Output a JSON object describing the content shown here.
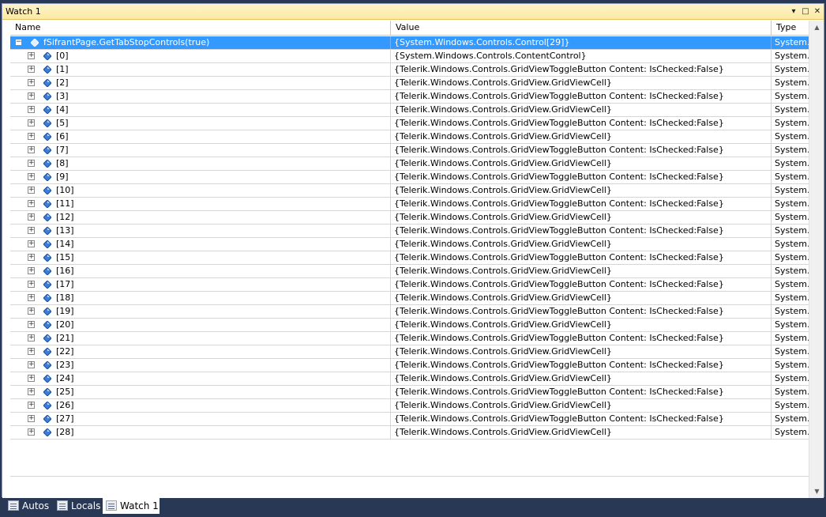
{
  "window": {
    "title": "Watch 1",
    "controls": {
      "dropdown": "▾",
      "maximize": "□",
      "close": "✕"
    }
  },
  "columns": {
    "name": "Name",
    "value": "Value",
    "type": "Type"
  },
  "root": {
    "expander": "−",
    "name": "fSifrantPage.GetTabStopControls(true)",
    "value": "{System.Windows.Controls.Control[29]}",
    "type": "System.W"
  },
  "rows": [
    {
      "name": "[0]",
      "value": "{System.Windows.Controls.ContentControl}",
      "type": "System.W"
    },
    {
      "name": "[1]",
      "value": "{Telerik.Windows.Controls.GridViewToggleButton Content: IsChecked:False}",
      "type": "System.W"
    },
    {
      "name": "[2]",
      "value": "{Telerik.Windows.Controls.GridView.GridViewCell}",
      "type": "System.W"
    },
    {
      "name": "[3]",
      "value": "{Telerik.Windows.Controls.GridViewToggleButton Content: IsChecked:False}",
      "type": "System.W"
    },
    {
      "name": "[4]",
      "value": "{Telerik.Windows.Controls.GridView.GridViewCell}",
      "type": "System.W"
    },
    {
      "name": "[5]",
      "value": "{Telerik.Windows.Controls.GridViewToggleButton Content: IsChecked:False}",
      "type": "System.W"
    },
    {
      "name": "[6]",
      "value": "{Telerik.Windows.Controls.GridView.GridViewCell}",
      "type": "System.W"
    },
    {
      "name": "[7]",
      "value": "{Telerik.Windows.Controls.GridViewToggleButton Content: IsChecked:False}",
      "type": "System.W"
    },
    {
      "name": "[8]",
      "value": "{Telerik.Windows.Controls.GridView.GridViewCell}",
      "type": "System.W"
    },
    {
      "name": "[9]",
      "value": "{Telerik.Windows.Controls.GridViewToggleButton Content: IsChecked:False}",
      "type": "System.W"
    },
    {
      "name": "[10]",
      "value": "{Telerik.Windows.Controls.GridView.GridViewCell}",
      "type": "System.W"
    },
    {
      "name": "[11]",
      "value": "{Telerik.Windows.Controls.GridViewToggleButton Content: IsChecked:False}",
      "type": "System.W"
    },
    {
      "name": "[12]",
      "value": "{Telerik.Windows.Controls.GridView.GridViewCell}",
      "type": "System.W"
    },
    {
      "name": "[13]",
      "value": "{Telerik.Windows.Controls.GridViewToggleButton Content: IsChecked:False}",
      "type": "System.W"
    },
    {
      "name": "[14]",
      "value": "{Telerik.Windows.Controls.GridView.GridViewCell}",
      "type": "System.W"
    },
    {
      "name": "[15]",
      "value": "{Telerik.Windows.Controls.GridViewToggleButton Content: IsChecked:False}",
      "type": "System.W"
    },
    {
      "name": "[16]",
      "value": "{Telerik.Windows.Controls.GridView.GridViewCell}",
      "type": "System.W"
    },
    {
      "name": "[17]",
      "value": "{Telerik.Windows.Controls.GridViewToggleButton Content: IsChecked:False}",
      "type": "System.W"
    },
    {
      "name": "[18]",
      "value": "{Telerik.Windows.Controls.GridView.GridViewCell}",
      "type": "System.W"
    },
    {
      "name": "[19]",
      "value": "{Telerik.Windows.Controls.GridViewToggleButton Content: IsChecked:False}",
      "type": "System.W"
    },
    {
      "name": "[20]",
      "value": "{Telerik.Windows.Controls.GridView.GridViewCell}",
      "type": "System.W"
    },
    {
      "name": "[21]",
      "value": "{Telerik.Windows.Controls.GridViewToggleButton Content: IsChecked:False}",
      "type": "System.W"
    },
    {
      "name": "[22]",
      "value": "{Telerik.Windows.Controls.GridView.GridViewCell}",
      "type": "System.W"
    },
    {
      "name": "[23]",
      "value": "{Telerik.Windows.Controls.GridViewToggleButton Content: IsChecked:False}",
      "type": "System.W"
    },
    {
      "name": "[24]",
      "value": "{Telerik.Windows.Controls.GridView.GridViewCell}",
      "type": "System.W"
    },
    {
      "name": "[25]",
      "value": "{Telerik.Windows.Controls.GridViewToggleButton Content: IsChecked:False}",
      "type": "System.W"
    },
    {
      "name": "[26]",
      "value": "{Telerik.Windows.Controls.GridView.GridViewCell}",
      "type": "System.W"
    },
    {
      "name": "[27]",
      "value": "{Telerik.Windows.Controls.GridViewToggleButton Content: IsChecked:False}",
      "type": "System.W"
    },
    {
      "name": "[28]",
      "value": "{Telerik.Windows.Controls.GridView.GridViewCell}",
      "type": "System.W"
    }
  ],
  "child_expander": "+",
  "scrollbar": {
    "up": "▲",
    "down": "▼"
  },
  "tabs": [
    {
      "label": "Autos",
      "icon": "autos-window-icon",
      "active": false
    },
    {
      "label": "Locals",
      "icon": "locals-window-icon",
      "active": false
    },
    {
      "label": "Watch 1",
      "icon": "watch-window-icon",
      "active": true
    }
  ],
  "colors": {
    "selection": "#3399ff",
    "title_bar": "#fce9a4",
    "chrome": "#293955"
  }
}
